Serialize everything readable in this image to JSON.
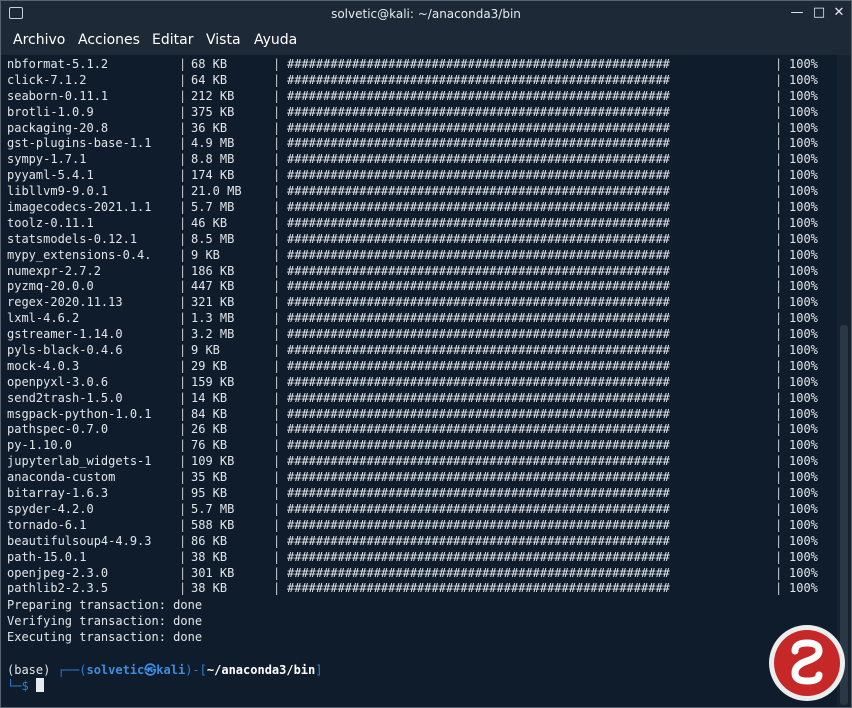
{
  "window": {
    "title": "solvetic@kali: ~/anaconda3/bin"
  },
  "menu": {
    "items": [
      "Archivo",
      "Acciones",
      "Editar",
      "Vista",
      "Ayuda"
    ]
  },
  "terminal": {
    "separator": "|",
    "bar": "#####################################################",
    "packages": [
      {
        "name": "nbformat-5.1.2",
        "size": "68 KB",
        "pct": "100%"
      },
      {
        "name": "click-7.1.2",
        "size": "64 KB",
        "pct": "100%"
      },
      {
        "name": "seaborn-0.11.1",
        "size": "212 KB",
        "pct": "100%"
      },
      {
        "name": "brotli-1.0.9",
        "size": "375 KB",
        "pct": "100%"
      },
      {
        "name": "packaging-20.8",
        "size": "36 KB",
        "pct": "100%"
      },
      {
        "name": "gst-plugins-base-1.1",
        "size": "4.9 MB",
        "pct": "100%"
      },
      {
        "name": "sympy-1.7.1",
        "size": "8.8 MB",
        "pct": "100%"
      },
      {
        "name": "pyyaml-5.4.1",
        "size": "174 KB",
        "pct": "100%"
      },
      {
        "name": "libllvm9-9.0.1",
        "size": "21.0 MB",
        "pct": "100%"
      },
      {
        "name": "imagecodecs-2021.1.1",
        "size": "5.7 MB",
        "pct": "100%"
      },
      {
        "name": "toolz-0.11.1",
        "size": "46 KB",
        "pct": "100%"
      },
      {
        "name": "statsmodels-0.12.1",
        "size": "8.5 MB",
        "pct": "100%"
      },
      {
        "name": "mypy_extensions-0.4.",
        "size": "9 KB",
        "pct": "100%"
      },
      {
        "name": "numexpr-2.7.2",
        "size": "186 KB",
        "pct": "100%"
      },
      {
        "name": "pyzmq-20.0.0",
        "size": "447 KB",
        "pct": "100%"
      },
      {
        "name": "regex-2020.11.13",
        "size": "321 KB",
        "pct": "100%"
      },
      {
        "name": "lxml-4.6.2",
        "size": "1.3 MB",
        "pct": "100%"
      },
      {
        "name": "gstreamer-1.14.0",
        "size": "3.2 MB",
        "pct": "100%"
      },
      {
        "name": "pyls-black-0.4.6",
        "size": "9 KB",
        "pct": "100%"
      },
      {
        "name": "mock-4.0.3",
        "size": "29 KB",
        "pct": "100%"
      },
      {
        "name": "openpyxl-3.0.6",
        "size": "159 KB",
        "pct": "100%"
      },
      {
        "name": "send2trash-1.5.0",
        "size": "14 KB",
        "pct": "100%"
      },
      {
        "name": "msgpack-python-1.0.1",
        "size": "84 KB",
        "pct": "100%"
      },
      {
        "name": "pathspec-0.7.0",
        "size": "26 KB",
        "pct": "100%"
      },
      {
        "name": "py-1.10.0",
        "size": "76 KB",
        "pct": "100%"
      },
      {
        "name": "jupyterlab_widgets-1",
        "size": "109 KB",
        "pct": "100%"
      },
      {
        "name": "anaconda-custom",
        "size": "35 KB",
        "pct": "100%"
      },
      {
        "name": "bitarray-1.6.3",
        "size": "95 KB",
        "pct": "100%"
      },
      {
        "name": "spyder-4.2.0",
        "size": "5.7 MB",
        "pct": "100%"
      },
      {
        "name": "tornado-6.1",
        "size": "588 KB",
        "pct": "100%"
      },
      {
        "name": "beautifulsoup4-4.9.3",
        "size": "86 KB",
        "pct": "100%"
      },
      {
        "name": "path-15.0.1",
        "size": "38 KB",
        "pct": "100%"
      },
      {
        "name": "openjpeg-2.3.0",
        "size": "301 KB",
        "pct": "100%"
      },
      {
        "name": "pathlib2-2.3.5",
        "size": "38 KB",
        "pct": "100%"
      }
    ],
    "status_lines": [
      "Preparing transaction: done",
      "Verifying transaction: done",
      "Executing transaction: done"
    ],
    "prompt": {
      "env": "(base) ",
      "open": "┌──(",
      "user": "solvetic",
      "at": "㉿",
      "host": "kali",
      "mid": ")-[",
      "path": "~/anaconda3/bin",
      "close": "]",
      "line2": "└─$ "
    }
  },
  "colors": {
    "background": "#0f1c2b",
    "text": "#e2e6ea",
    "prompt_blue": "#2f7dd3"
  }
}
